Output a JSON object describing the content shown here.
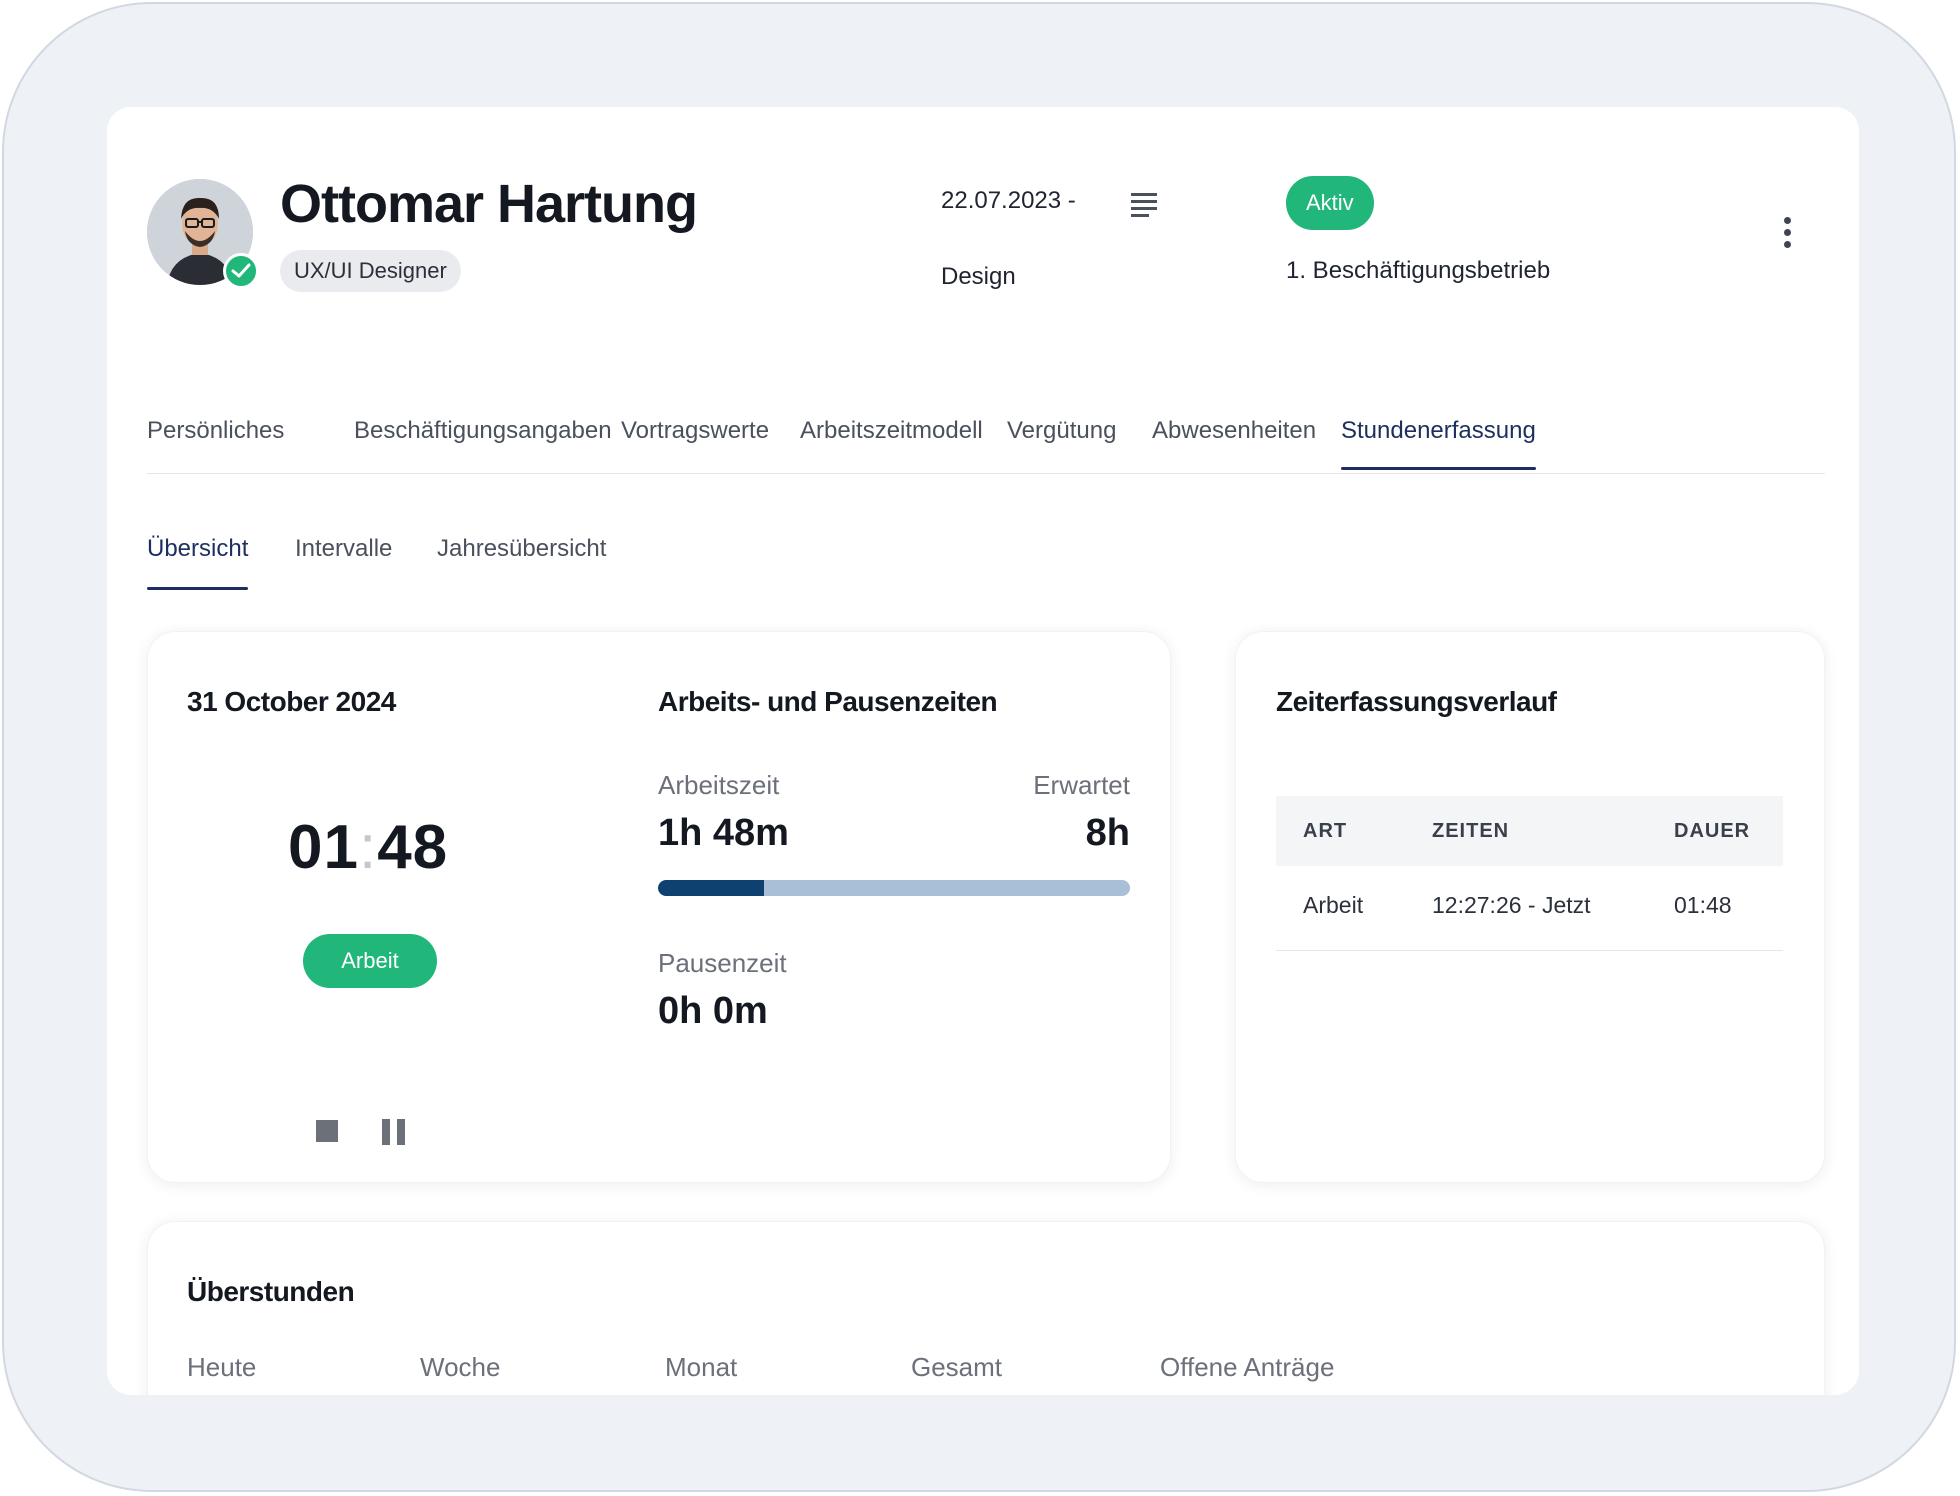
{
  "profile": {
    "name": "Ottomar Hartung",
    "role": "UX/UI Designer",
    "date_range": "22.07.2023 -",
    "department": "Design",
    "status": "Aktiv",
    "company": "1. Beschäftigungsbetrieb",
    "verified_icon": "check-icon",
    "colors": {
      "status": "#21b67a",
      "accent": "#1d2f5e"
    }
  },
  "tabs": [
    {
      "label": "Persönliches"
    },
    {
      "label": "Beschäftigungsangaben"
    },
    {
      "label": "Vortragswerte"
    },
    {
      "label": "Arbeitszeitmodell"
    },
    {
      "label": "Vergütung"
    },
    {
      "label": "Abwesenheiten"
    },
    {
      "label": "Stundenerfassung",
      "active": true
    }
  ],
  "subtabs": [
    {
      "label": "Übersicht",
      "active": true
    },
    {
      "label": "Intervalle"
    },
    {
      "label": "Jahresübersicht"
    }
  ],
  "today": {
    "date": "31 October 2024",
    "timer_hours": "01",
    "timer_sep": ":",
    "timer_minutes": "48",
    "state_button": "Arbeit",
    "stop_icon": "stop-icon",
    "pause_icon": "pause-icon"
  },
  "times": {
    "title": "Arbeits- und Pausenzeiten",
    "work_label": "Arbeitszeit",
    "work_value": "1h 48m",
    "expected_label": "Erwartet",
    "expected_value": "8h",
    "progress": 0.225,
    "break_label": "Pausenzeit",
    "break_value": "0h 0m"
  },
  "history": {
    "title": "Zeiterfassungsverlauf",
    "columns": [
      "ART",
      "ZEITEN",
      "DAUER"
    ],
    "rows": [
      [
        "Arbeit",
        "12:27:26 - Jetzt",
        "01:48"
      ]
    ]
  },
  "overtime": {
    "title": "Überstunden",
    "columns": [
      "Heute",
      "Woche",
      "Monat",
      "Gesamt",
      "Offene Anträge"
    ]
  }
}
